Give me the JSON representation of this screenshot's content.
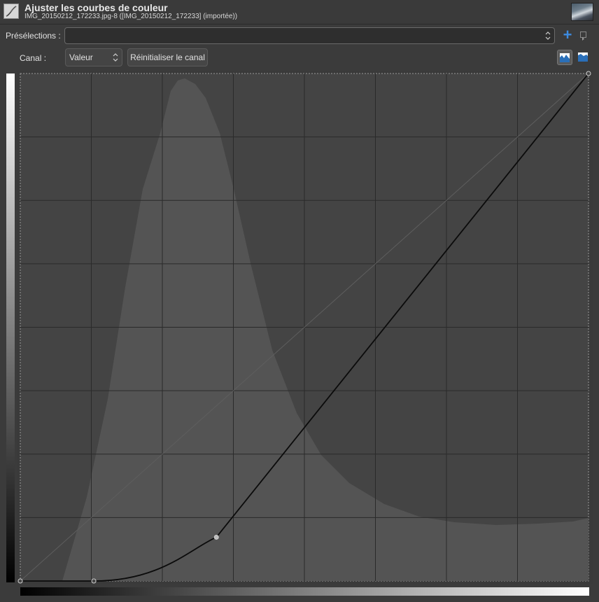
{
  "header": {
    "title": "Ajuster les courbes de couleur",
    "subtitle": "IMG_20150212_172233.jpg-8 ([IMG_20150212_172233] (importée))",
    "tool_icon": "curves-tool-icon",
    "thumbnail": "image-thumbnail"
  },
  "presets": {
    "label": "Présélections :",
    "value": "",
    "add_icon": "plus-icon",
    "menu_icon": "menu-icon"
  },
  "channel": {
    "label": "Canal :",
    "value": "Valeur",
    "reset_label": "Réinitialiser le canal",
    "linear_hist_icon": "linear-histogram-icon",
    "log_hist_icon": "log-histogram-icon"
  },
  "curve": {
    "domain": [
      0,
      255
    ],
    "points": [
      [
        0,
        0
      ],
      [
        33,
        0
      ],
      [
        88,
        22
      ],
      [
        255,
        255
      ]
    ],
    "grid_divisions": 8,
    "histogram_mode": "linear"
  },
  "colors": {
    "background": "#3b3b3b",
    "graph_bg": "#444444",
    "histogram": "#545454",
    "grid": "#2a2a2a",
    "curve": "#0b0b0b",
    "accent": "#3d8be0"
  }
}
